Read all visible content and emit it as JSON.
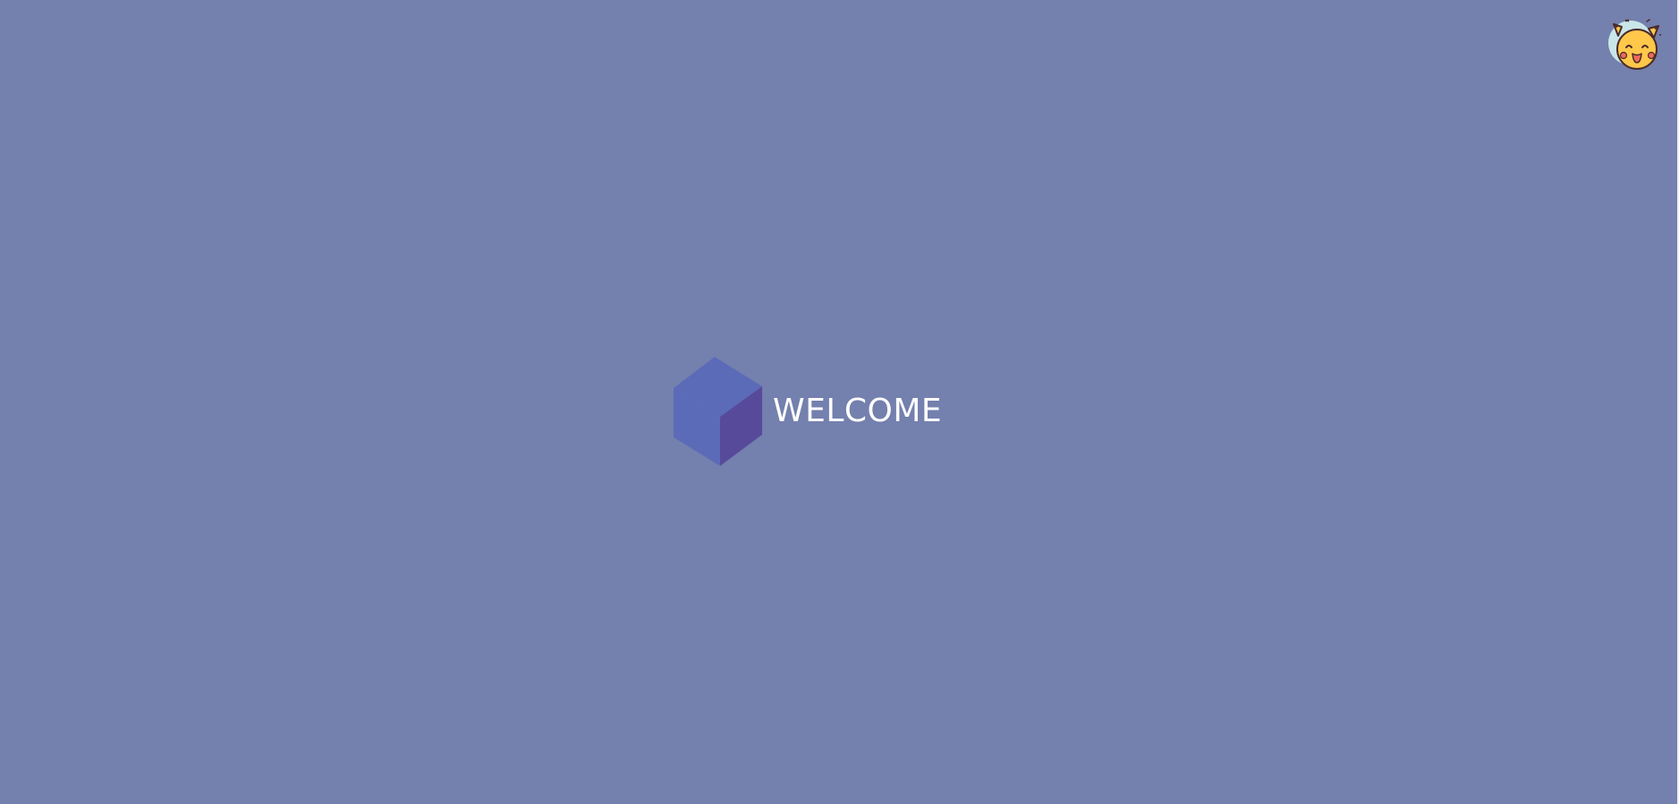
{
  "welcome": {
    "text": "WELCOME",
    "logo_icon": "cube-icon"
  },
  "user": {
    "avatar_icon": "pikachu-avatar-icon"
  },
  "colors": {
    "background": "#7480ad",
    "cube_top": "#5b6bb8",
    "cube_side": "#574a9a",
    "text": "#ffffff",
    "avatar_bg": "#c9e6e8",
    "avatar_face": "#ffc84a",
    "avatar_outline": "#4a2a2a",
    "avatar_cheek": "#ef6a5a"
  }
}
